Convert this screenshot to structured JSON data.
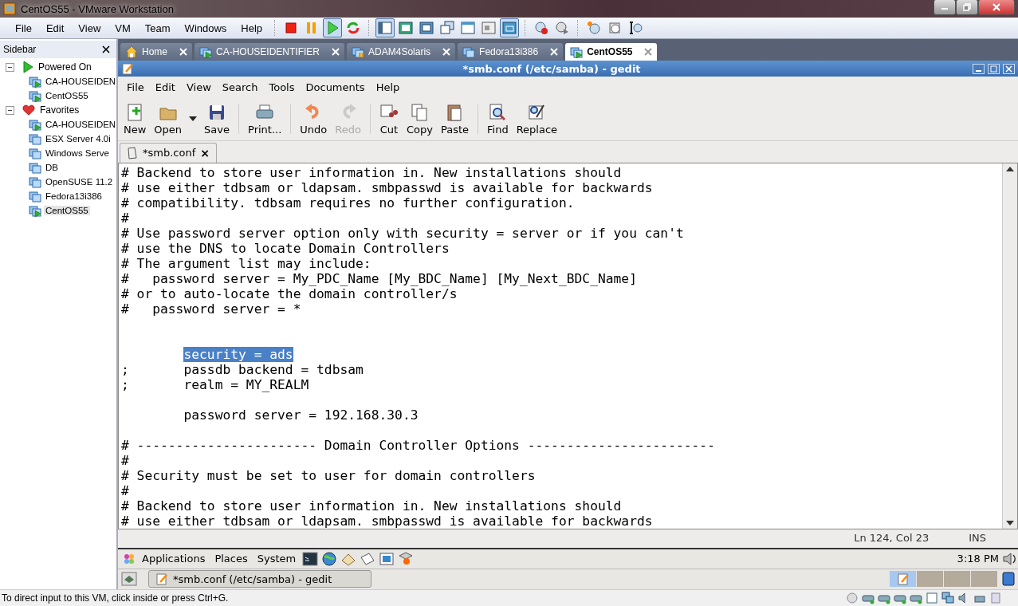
{
  "window": {
    "title": "CentOS55 - VMware Workstation"
  },
  "host_menu": [
    "File",
    "Edit",
    "View",
    "VM",
    "Team",
    "Windows",
    "Help"
  ],
  "host_toolbar": [
    {
      "pressed": false
    },
    {
      "pressed": false
    },
    {
      "pressed": true
    },
    {
      "pressed": false
    },
    {
      "pressed": true
    },
    {
      "pressed": false
    },
    {
      "pressed": false
    },
    {
      "pressed": false
    },
    {
      "pressed": false
    },
    {
      "pressed": false
    },
    {
      "pressed": true
    },
    {
      "pressed": false
    },
    {
      "pressed": false
    },
    {
      "pressed": false
    },
    {
      "pressed": false
    },
    {
      "pressed": false
    }
  ],
  "sidebar": {
    "title": "Sidebar",
    "groups": [
      {
        "label": "Powered On",
        "kind": "running",
        "expanded": true,
        "children": [
          {
            "label": "CA-HOUSEIDEN",
            "running": true,
            "selected": false
          },
          {
            "label": "CentOS55",
            "running": true,
            "selected": false
          }
        ]
      },
      {
        "label": "Favorites",
        "kind": "favorites",
        "expanded": true,
        "children": [
          {
            "label": "CA-HOUSEIDEN",
            "running": true,
            "selected": false
          },
          {
            "label": "ESX Server 4.0i",
            "running": false,
            "selected": false
          },
          {
            "label": "Windows Serve",
            "running": false,
            "selected": false
          },
          {
            "label": "DB",
            "running": false,
            "selected": false
          },
          {
            "label": "OpenSUSE 11.2",
            "running": false,
            "selected": false
          },
          {
            "label": "Fedora13i386",
            "running": false,
            "selected": false
          },
          {
            "label": "CentOS55",
            "running": true,
            "selected": true
          }
        ]
      }
    ]
  },
  "tabs": [
    {
      "label": "Home",
      "kind": "home",
      "selected": false
    },
    {
      "label": "CA-HOUSEIDENTIFIER",
      "kind": "vm",
      "running": true,
      "selected": false
    },
    {
      "label": "ADAM4Solaris",
      "kind": "vm",
      "running": false,
      "paused": true,
      "selected": false
    },
    {
      "label": "Fedora13i386",
      "kind": "vm",
      "running": false,
      "selected": false
    },
    {
      "label": "CentOS55",
      "kind": "vm",
      "running": true,
      "selected": true
    }
  ],
  "gedit": {
    "title": "*smb.conf (/etc/samba) - gedit",
    "menu": [
      "File",
      "Edit",
      "View",
      "Search",
      "Tools",
      "Documents",
      "Help"
    ],
    "toolbar": [
      {
        "label": "New",
        "disabled": false,
        "dropdown": false
      },
      {
        "label": "Open",
        "disabled": false,
        "dropdown": true
      },
      {
        "label": "Save",
        "disabled": false,
        "dropdown": false
      },
      {
        "label": "Print...",
        "disabled": false,
        "dropdown": false
      },
      {
        "label": "Undo",
        "disabled": false,
        "dropdown": false
      },
      {
        "label": "Redo",
        "disabled": true,
        "dropdown": false
      },
      {
        "label": "Cut",
        "disabled": false,
        "dropdown": false
      },
      {
        "label": "Copy",
        "disabled": false,
        "dropdown": false
      },
      {
        "label": "Paste",
        "disabled": false,
        "dropdown": false
      },
      {
        "label": "Find",
        "disabled": false,
        "dropdown": false
      },
      {
        "label": "Replace",
        "disabled": false,
        "dropdown": false
      }
    ],
    "doc_tab": {
      "label": "*smb.conf",
      "close": "×"
    },
    "lines": [
      {
        "text": "# Backend to store user information in. New installations should"
      },
      {
        "text": "# use either tdbsam or ldapsam. smbpasswd is available for backwards"
      },
      {
        "text": "# compatibility. tdbsam requires no further configuration."
      },
      {
        "text": "#"
      },
      {
        "text": "# Use password server option only with security = server or if you can't"
      },
      {
        "text": "# use the DNS to locate Domain Controllers"
      },
      {
        "text": "# The argument list may include:"
      },
      {
        "text": "#   password server = My_PDC_Name [My_BDC_Name] [My_Next_BDC_Name]"
      },
      {
        "text": "# or to auto-locate the domain controller/s"
      },
      {
        "text": "#   password server = *"
      },
      {
        "kind": "blank"
      },
      {
        "kind": "blank"
      },
      {
        "text": "        security = ads",
        "selected": true
      },
      {
        "text": ";       passdb backend = tdbsam"
      },
      {
        "text": ";       realm = MY_REALM"
      },
      {
        "kind": "blank"
      },
      {
        "text": "        password server = 192.168.30.3"
      },
      {
        "kind": "blank"
      },
      {
        "text": "# ----------------------- Domain Controller Options ------------------------"
      },
      {
        "text": "#"
      },
      {
        "text": "# Security must be set to user for domain controllers"
      },
      {
        "text": "#"
      },
      {
        "text": "# Backend to store user information in. New installations should"
      },
      {
        "text": "# use either tdbsam or ldapsam. smbpasswd is available for backwards"
      }
    ],
    "status": {
      "position": "Ln 124, Col 23",
      "mode": "INS"
    }
  },
  "gnome_panel": {
    "menus": [
      "Applications",
      "Places",
      "System"
    ],
    "clock": "3:18 PM"
  },
  "gnome_taskbar": {
    "windows": [
      {
        "label": "*smb.conf (/etc/samba) - gedit",
        "selected": false
      }
    ],
    "workspaces": [
      {
        "selected": true
      },
      {
        "selected": false
      },
      {
        "selected": false
      },
      {
        "selected": false
      }
    ]
  },
  "status_bar": {
    "text": "To direct input to this VM, click inside or press Ctrl+G."
  }
}
